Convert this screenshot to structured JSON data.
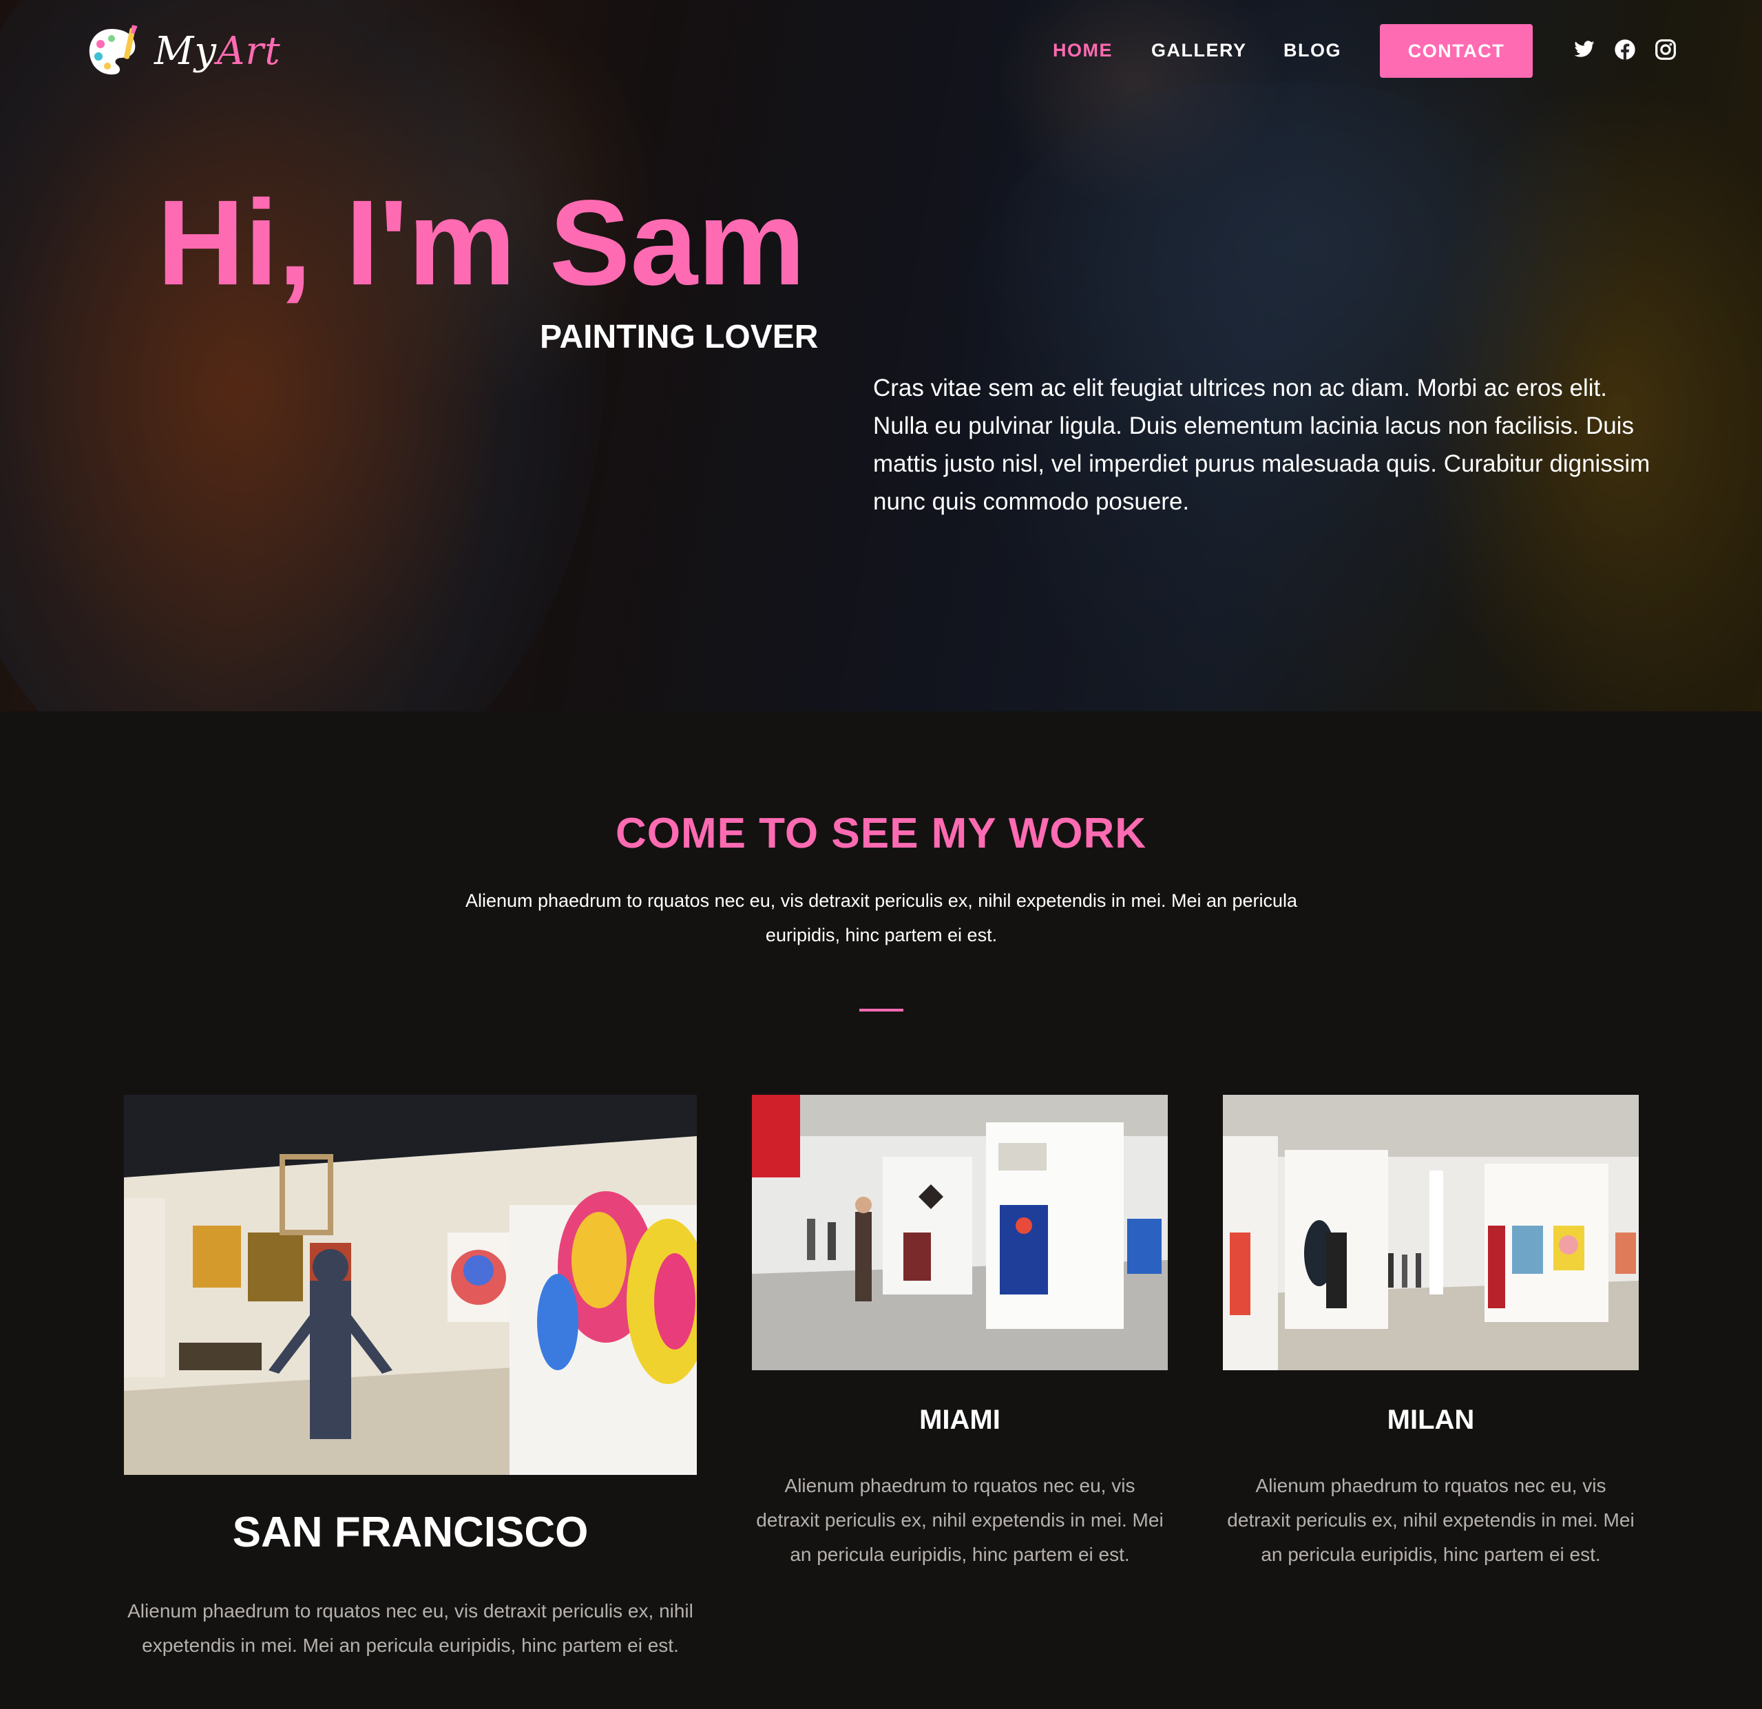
{
  "brand": {
    "logo_prefix": "My",
    "logo_accent": "Art"
  },
  "nav": {
    "home": "HOME",
    "gallery": "GALLERY",
    "blog": "BLOG",
    "contact": "CONTACT"
  },
  "social": [
    "twitter-icon",
    "facebook-icon",
    "instagram-icon"
  ],
  "hero": {
    "title": "Hi, I'm Sam",
    "subtitle": "PAINTING LOVER",
    "description": "Cras vitae sem ac elit feugiat ultrices non ac diam. Morbi ac eros elit. Nulla eu pulvinar ligula. Duis elementum lacinia lacus non facilisis. Duis mattis justo nisl, vel imperdiet purus malesuada quis. Curabitur dignissim nunc quis commodo posuere."
  },
  "work": {
    "title": "COME TO SEE MY WORK",
    "intro": "Alienum phaedrum to rquatos nec eu, vis detraxit periculis ex, nihil expetendis in mei. Mei an pericula euripidis, hinc partem ei est.",
    "cards": [
      {
        "title": "SAN FRANCISCO",
        "text": "Alienum phaedrum to rquatos nec eu, vis detraxit periculis ex, nihil expetendis in mei. Mei an pericula euripidis, hinc partem ei est."
      },
      {
        "title": "MIAMI",
        "text": "Alienum phaedrum to rquatos nec eu, vis detraxit periculis ex, nihil expetendis in mei. Mei an pericula euripidis, hinc partem ei est."
      },
      {
        "title": "MILAN",
        "text": "Alienum phaedrum to rquatos nec eu, vis detraxit periculis ex, nihil expetendis in mei. Mei an pericula euripidis, hinc partem ei est."
      }
    ]
  },
  "colors": {
    "accent": "#ff6bb2",
    "background": "#141211",
    "muted_text": "#b5b1ad"
  }
}
